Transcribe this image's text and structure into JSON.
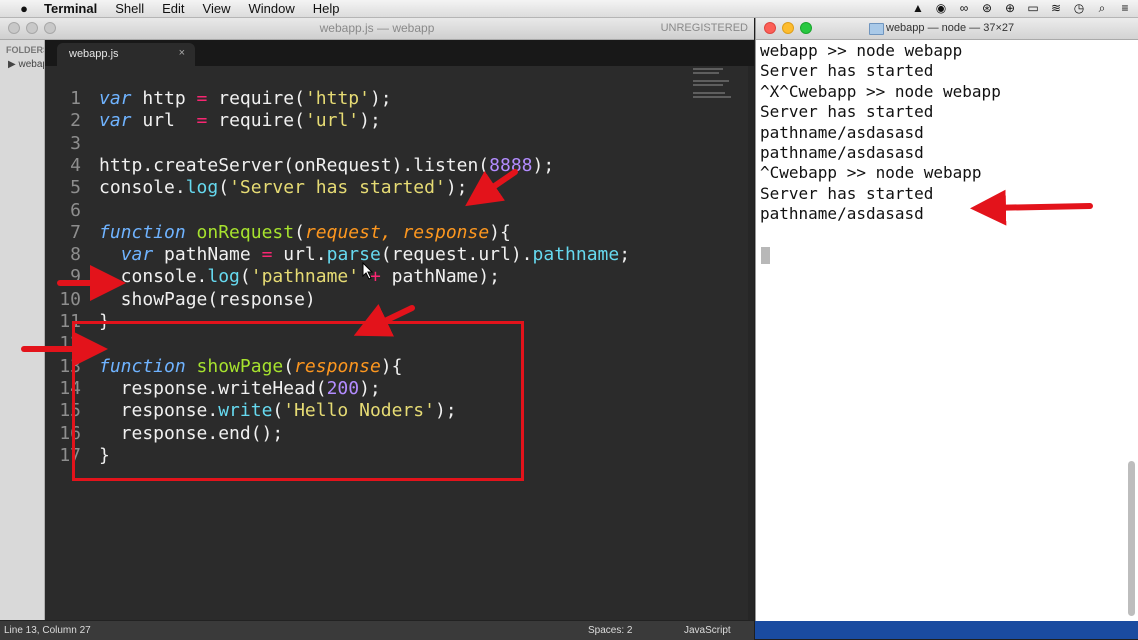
{
  "menubar": {
    "app_name": "Terminal",
    "items": [
      "Shell",
      "Edit",
      "View",
      "Window",
      "Help"
    ]
  },
  "editor": {
    "title": "webapp.js — webapp",
    "unregistered": "UNREGISTERED",
    "sidebar": {
      "header": "FOLDERS",
      "item": "webapp"
    },
    "tab": {
      "label": "webapp.js",
      "close": "×"
    },
    "lines": [
      {
        "n": "1",
        "tokens": [
          [
            "kw",
            "var"
          ],
          [
            "p",
            " http "
          ],
          [
            "op",
            "="
          ],
          [
            "p",
            " require("
          ],
          [
            "str",
            "'http'"
          ],
          [
            "p",
            ");"
          ]
        ]
      },
      {
        "n": "2",
        "tokens": [
          [
            "kw",
            "var"
          ],
          [
            "p",
            " url  "
          ],
          [
            "op",
            "="
          ],
          [
            "p",
            " require("
          ],
          [
            "str",
            "'url'"
          ],
          [
            "p",
            ");"
          ]
        ]
      },
      {
        "n": "3",
        "tokens": []
      },
      {
        "n": "4",
        "tokens": [
          [
            "p",
            "http.createServer(onRequest).listen("
          ],
          [
            "num",
            "8888"
          ],
          [
            "p",
            ");"
          ]
        ]
      },
      {
        "n": "5",
        "tokens": [
          [
            "p",
            "console."
          ],
          [
            "mth",
            "log"
          ],
          [
            "p",
            "("
          ],
          [
            "str",
            "'Server has started'"
          ],
          [
            "p",
            ");"
          ]
        ]
      },
      {
        "n": "6",
        "tokens": []
      },
      {
        "n": "7",
        "tokens": [
          [
            "kw",
            "function"
          ],
          [
            "p",
            " "
          ],
          [
            "fn",
            "onRequest"
          ],
          [
            "p",
            "("
          ],
          [
            "prm",
            "request, response"
          ],
          [
            "p",
            "){"
          ]
        ]
      },
      {
        "n": "8",
        "tokens": [
          [
            "p",
            "  "
          ],
          [
            "kw",
            "var"
          ],
          [
            "p",
            " pathName "
          ],
          [
            "op",
            "="
          ],
          [
            "p",
            " url."
          ],
          [
            "mth",
            "parse"
          ],
          [
            "p",
            "(request.url)."
          ],
          [
            "mth",
            "pathname"
          ],
          [
            "p",
            ";"
          ]
        ]
      },
      {
        "n": "9",
        "tokens": [
          [
            "p",
            "  console."
          ],
          [
            "mth",
            "log"
          ],
          [
            "p",
            "("
          ],
          [
            "str",
            "'pathname'"
          ],
          [
            "p",
            " "
          ],
          [
            "op",
            "+"
          ],
          [
            "p",
            " pathName);"
          ]
        ]
      },
      {
        "n": "10",
        "tokens": [
          [
            "p",
            "  showPage(response)"
          ]
        ]
      },
      {
        "n": "11",
        "tokens": [
          [
            "p",
            "}"
          ]
        ]
      },
      {
        "n": "12",
        "tokens": []
      },
      {
        "n": "13",
        "tokens": [
          [
            "kw",
            "function"
          ],
          [
            "p",
            " "
          ],
          [
            "fn",
            "showPage"
          ],
          [
            "p",
            "("
          ],
          [
            "prm",
            "response"
          ],
          [
            "p",
            "){"
          ]
        ]
      },
      {
        "n": "14",
        "tokens": [
          [
            "p",
            "  response.writeHead("
          ],
          [
            "num",
            "200"
          ],
          [
            "p",
            ");"
          ]
        ]
      },
      {
        "n": "15",
        "tokens": [
          [
            "p",
            "  response."
          ],
          [
            "mth",
            "write"
          ],
          [
            "p",
            "("
          ],
          [
            "str",
            "'Hello Noders'"
          ],
          [
            "p",
            ");"
          ]
        ]
      },
      {
        "n": "16",
        "tokens": [
          [
            "p",
            "  response.end();"
          ]
        ]
      },
      {
        "n": "17",
        "tokens": [
          [
            "p",
            "}"
          ]
        ]
      }
    ],
    "status": {
      "position": "Line 13, Column 27",
      "spaces": "Spaces: 2",
      "syntax": "JavaScript"
    }
  },
  "terminal": {
    "title": "webapp — node — 37×27",
    "lines": [
      "webapp >> node webapp",
      "Server has started",
      "^X^Cwebapp >> node webapp",
      "Server has started",
      "pathname/asdasasd",
      "pathname/asdasasd",
      "^Cwebapp >> node webapp",
      "Server has started",
      "pathname/asdasasd"
    ]
  },
  "colors": {
    "annotation_red": "#e3131b",
    "keyword": "#6fb3ff",
    "function_name": "#a6e22e",
    "string": "#e6db74",
    "number": "#b38cff",
    "parameter": "#fd971f",
    "operator": "#f92672"
  }
}
